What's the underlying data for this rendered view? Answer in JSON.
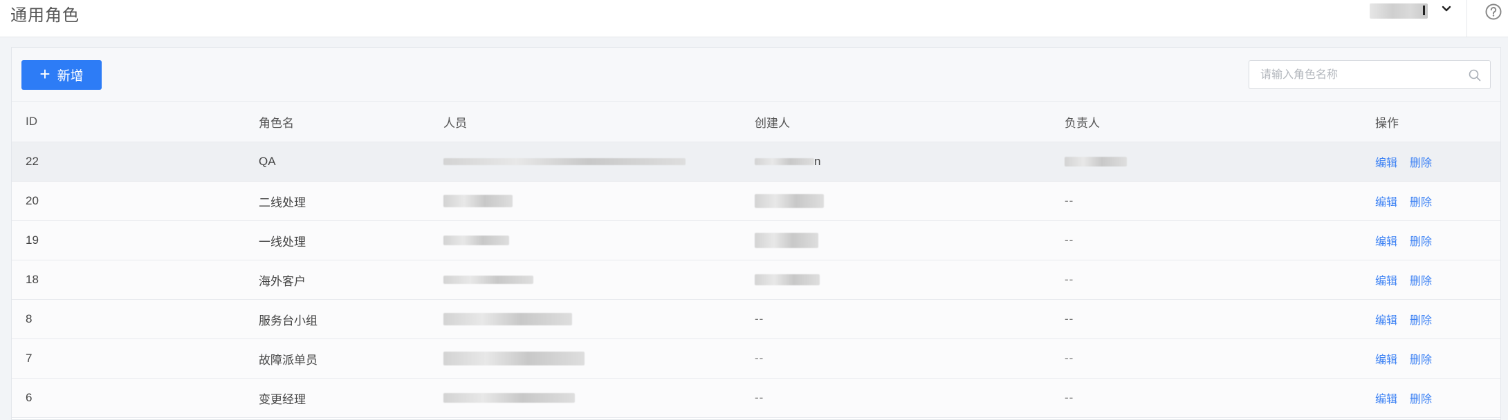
{
  "header": {
    "title": "通用角色",
    "dropdown_icon": "chevron-down-icon",
    "help_icon": "question-circle-icon"
  },
  "toolbar": {
    "add_label": "新增",
    "add_icon": "plus-icon",
    "search_placeholder": "请输入角色名称",
    "search_value": ""
  },
  "colors": {
    "primary": "#2d7cf6",
    "link": "#3d82f4"
  },
  "table": {
    "columns": [
      "ID",
      "角色名",
      "人员",
      "创建人",
      "负责人",
      "操作"
    ],
    "rows": [
      {
        "id": "22",
        "name": "QA",
        "creator_suffix": "n",
        "owner": "",
        "edit": "编辑",
        "delete": "删除"
      },
      {
        "id": "20",
        "name": "二线处理",
        "creator_suffix": "",
        "owner": "--",
        "edit": "编辑",
        "delete": "删除"
      },
      {
        "id": "19",
        "name": "一线处理",
        "creator_suffix": "",
        "owner": "--",
        "edit": "编辑",
        "delete": "删除"
      },
      {
        "id": "18",
        "name": "海外客户",
        "creator_suffix": "",
        "owner": "--",
        "edit": "编辑",
        "delete": "删除"
      },
      {
        "id": "8",
        "name": "服务台小组",
        "creator": "--",
        "owner": "--",
        "edit": "编辑",
        "delete": "删除"
      },
      {
        "id": "7",
        "name": "故障派单员",
        "creator": "--",
        "owner": "--",
        "edit": "编辑",
        "delete": "删除"
      },
      {
        "id": "6",
        "name": "变更经理",
        "creator": "--",
        "owner": "--",
        "edit": "编辑",
        "delete": "删除"
      }
    ]
  }
}
